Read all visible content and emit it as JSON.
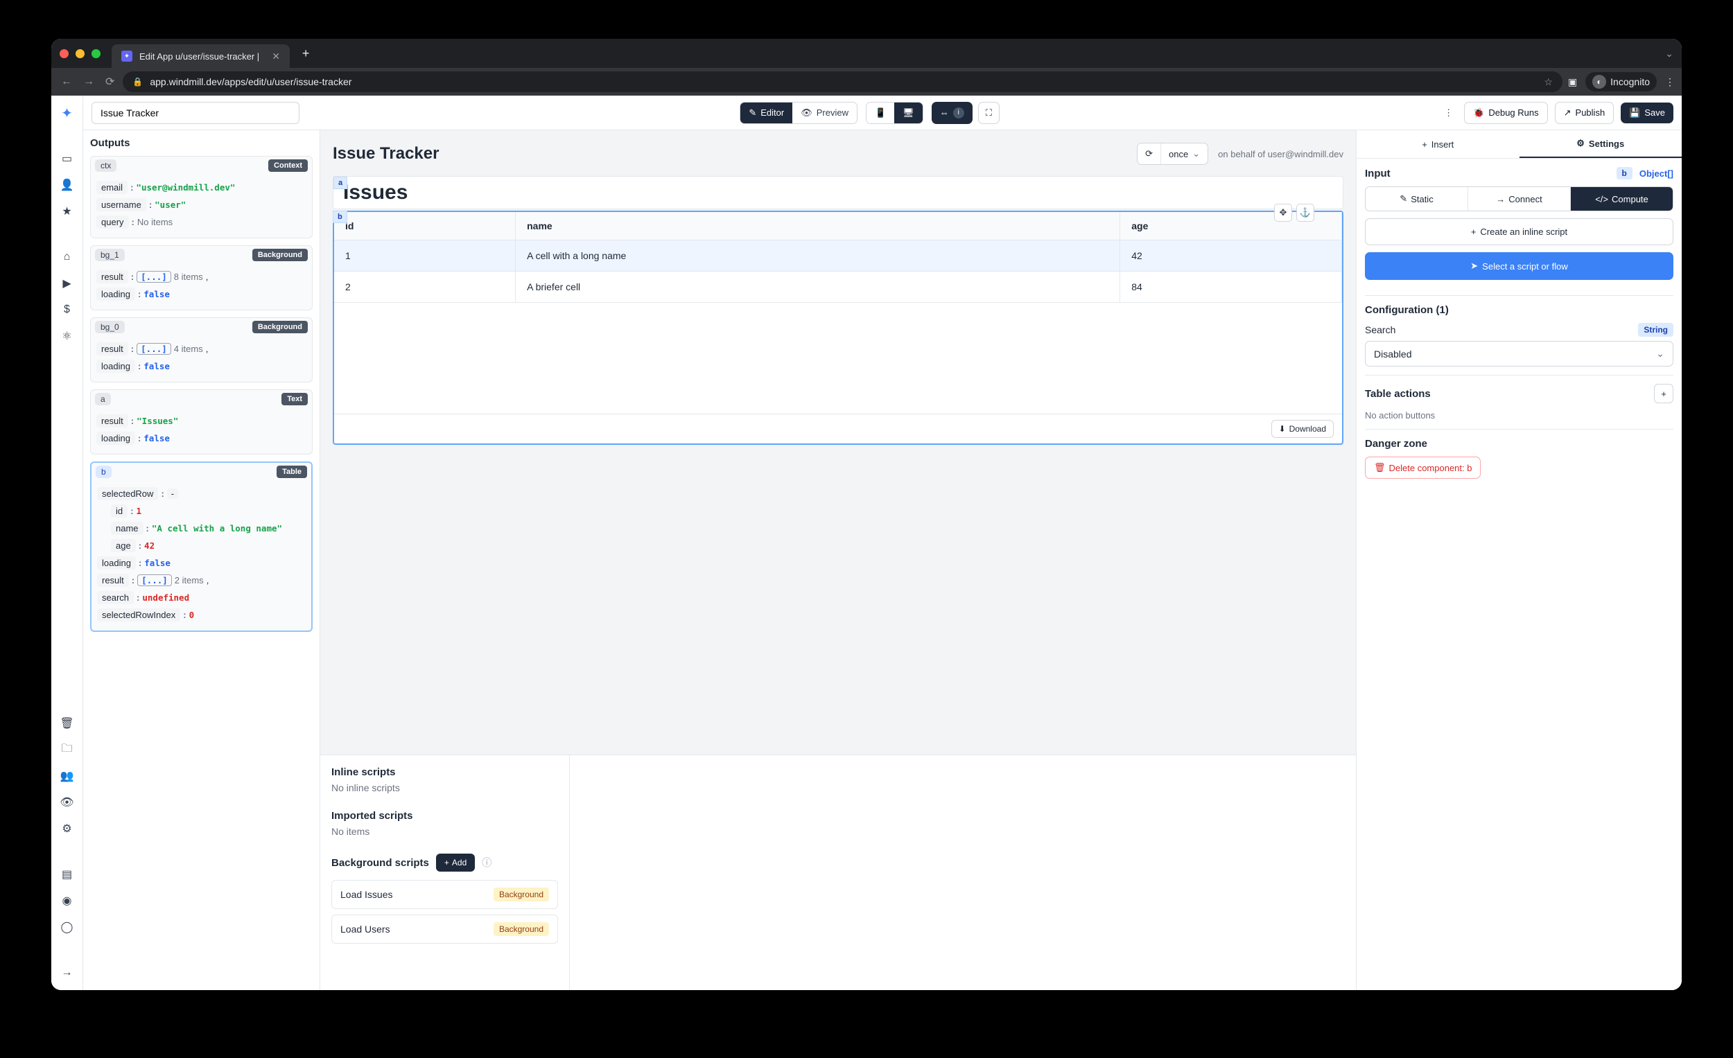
{
  "browser": {
    "tab_title": "Edit App u/user/issue-tracker |",
    "url": "app.windmill.dev/apps/edit/u/user/issue-tracker",
    "incognito": "Incognito"
  },
  "toolbar": {
    "app_name": "Issue Tracker",
    "editor": "Editor",
    "preview": "Preview",
    "debug_runs": "Debug Runs",
    "publish": "Publish",
    "save": "Save"
  },
  "outputs": {
    "title": "Outputs",
    "ctx": {
      "id": "ctx",
      "tag": "Context",
      "email_key": "email",
      "email_val": "\"user@windmill.dev\"",
      "username_key": "username",
      "username_val": "\"user\"",
      "query_key": "query",
      "query_val": "No items"
    },
    "bg1": {
      "id": "bg_1",
      "tag": "Background",
      "result_key": "result",
      "result_arr": "[...]",
      "result_count": "8 items",
      "comma": ",",
      "loading_key": "loading",
      "loading_val": "false"
    },
    "bg0": {
      "id": "bg_0",
      "tag": "Background",
      "result_key": "result",
      "result_arr": "[...]",
      "result_count": "4 items",
      "comma": ",",
      "loading_key": "loading",
      "loading_val": "false"
    },
    "a": {
      "id": "a",
      "tag": "Text",
      "result_key": "result",
      "result_val": "\"Issues\"",
      "loading_key": "loading",
      "loading_val": "false"
    },
    "b": {
      "id": "b",
      "tag": "Table",
      "selectedRow_key": "selectedRow",
      "selectedRow_dash": "-",
      "id_key": "id",
      "id_val": "1",
      "name_key": "name",
      "name_val": "\"A cell with a long name\"",
      "age_key": "age",
      "age_val": "42",
      "loading_key": "loading",
      "loading_val": "false",
      "result_key": "result",
      "result_arr": "[...]",
      "result_count": "2 items",
      "comma": ",",
      "search_key": "search",
      "search_val": "undefined",
      "selectedRowIndex_key": "selectedRowIndex",
      "selectedRowIndex_val": "0"
    }
  },
  "canvas": {
    "title": "Issue Tracker",
    "once": "once",
    "behalf": "on behalf of user@windmill.dev",
    "comp_a_label": "a",
    "issues_heading": "Issues",
    "comp_b_label": "b",
    "table": {
      "cols": {
        "id": "id",
        "name": "name",
        "age": "age"
      },
      "rows": [
        {
          "id": "1",
          "name": "A cell with a long name",
          "age": "42"
        },
        {
          "id": "2",
          "name": "A briefer cell",
          "age": "84"
        }
      ]
    },
    "download": "Download"
  },
  "scripts": {
    "inline_title": "Inline scripts",
    "inline_empty": "No inline scripts",
    "imported_title": "Imported scripts",
    "imported_empty": "No items",
    "bg_title": "Background scripts",
    "add": "Add",
    "bg_items": [
      {
        "name": "Load Issues",
        "tag": "Background"
      },
      {
        "name": "Load Users",
        "tag": "Background"
      }
    ]
  },
  "inspector": {
    "insert": "Insert",
    "settings": "Settings",
    "input": "Input",
    "input_badge": "b",
    "input_type": "Object[]",
    "static": "Static",
    "connect": "Connect",
    "compute": "Compute",
    "create_inline": "Create an inline script",
    "select_script": "Select a script or flow",
    "config_title": "Configuration (1)",
    "search_label": "Search",
    "search_type": "String",
    "search_value": "Disabled",
    "table_actions": "Table actions",
    "no_actions": "No action buttons",
    "danger_zone": "Danger zone",
    "delete_btn": "Delete component: b"
  }
}
